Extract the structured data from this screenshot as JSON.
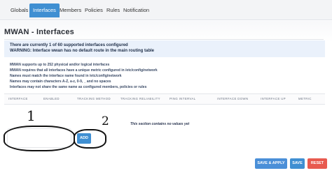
{
  "tabs": [
    {
      "label": "Globals"
    },
    {
      "label": "Interfaces"
    },
    {
      "label": "Members"
    },
    {
      "label": "Policies"
    },
    {
      "label": "Rules"
    },
    {
      "label": "Notification"
    }
  ],
  "page_title": "MWAN - Interfaces",
  "warnings": [
    "There are currently 1 of 60 supported interfaces configured",
    "WARNING: Interface wwan has no default route in the main routing table"
  ],
  "info_lines": [
    "MWAN supports up to 252 physical and/or logical interfaces",
    "MWAN requires that all interfaces have a unique metric configured in /etc/config/network",
    "Names must match the interface name found in /etc/config/network",
    "Names may contain characters A-Z, a-z, 0-9, _ and no spaces",
    "Interfaces may not share the same name as configured members, policies or rules"
  ],
  "table": {
    "headers": [
      "INTERFACE",
      "ENABLED",
      "TRACKING METHOD",
      "TRACKING RELIABILITY",
      "PING INTERVAL",
      "INTERFACE DOWN",
      "INTERFACE UP",
      "METRIC"
    ],
    "empty_message": "This section contains no values yet"
  },
  "annotations": {
    "one": "1",
    "two": "2"
  },
  "buttons": {
    "add": "ADD",
    "save_apply": "SAVE & APPLY",
    "save": "SAVE",
    "reset": "RESET"
  },
  "colors": {
    "accent": "#3f8fd2",
    "reset": "#e85a4f"
  }
}
